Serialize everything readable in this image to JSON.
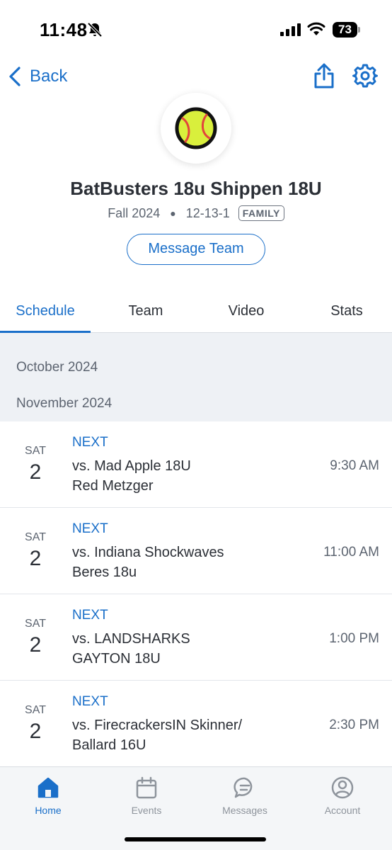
{
  "status_bar": {
    "time": "11:48",
    "battery": "73"
  },
  "nav": {
    "back_label": "Back"
  },
  "team": {
    "name": "BatBusters 18u Shippen 18U",
    "season": "Fall 2024",
    "record": "12-13-1",
    "role_badge": "FAMILY",
    "message_button": "Message Team"
  },
  "tabs": [
    {
      "label": "Schedule",
      "active": true
    },
    {
      "label": "Team",
      "active": false
    },
    {
      "label": "Video",
      "active": false
    },
    {
      "label": "Stats",
      "active": false
    }
  ],
  "schedule": {
    "months": [
      "October 2024",
      "November 2024"
    ],
    "games": [
      {
        "dow": "SAT",
        "day": "2",
        "status": "NEXT",
        "opponent_line1": "vs. Mad Apple 18U",
        "opponent_line2": "Red Metzger",
        "time": "9:30 AM"
      },
      {
        "dow": "SAT",
        "day": "2",
        "status": "NEXT",
        "opponent_line1": "vs. Indiana Shockwaves",
        "opponent_line2": "Beres 18u",
        "time": "11:00 AM"
      },
      {
        "dow": "SAT",
        "day": "2",
        "status": "NEXT",
        "opponent_line1": "vs. LANDSHARKS",
        "opponent_line2": "GAYTON 18U",
        "time": "1:00 PM"
      },
      {
        "dow": "SAT",
        "day": "2",
        "status": "NEXT",
        "opponent_line1": "vs. FirecrackersIN Skinner/",
        "opponent_line2": "Ballard 16U",
        "time": "2:30 PM"
      }
    ]
  },
  "tabbar": {
    "items": [
      {
        "label": "Home",
        "icon": "home-icon",
        "active": true
      },
      {
        "label": "Events",
        "icon": "calendar-icon",
        "active": false
      },
      {
        "label": "Messages",
        "icon": "chat-bubble-icon",
        "active": false
      },
      {
        "label": "Account",
        "icon": "user-circle-icon",
        "active": false
      }
    ]
  },
  "colors": {
    "accent": "#1a6fc9",
    "text": "#2b2f36",
    "muted": "#5c6470",
    "band": "#eef1f5",
    "softball": "#d9ef3c"
  }
}
